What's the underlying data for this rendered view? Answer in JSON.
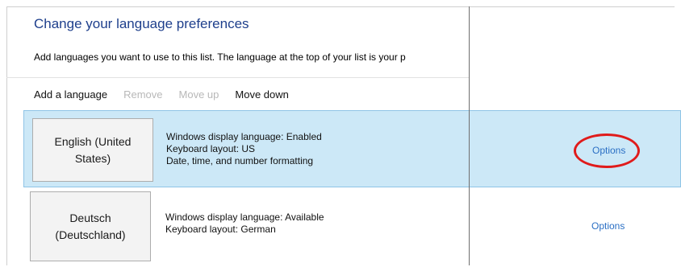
{
  "header": {
    "title": "Change your language preferences",
    "subtitle": "Add languages you want to use to this list. The language at the top of your list is your p"
  },
  "toolbar": {
    "add": "Add a language",
    "remove": "Remove",
    "move_up": "Move up",
    "move_down": "Move down"
  },
  "languages": [
    {
      "name_line1": "English (United",
      "name_line2": "States)",
      "display": "Windows display language: Enabled",
      "keyboard": "Keyboard layout: US",
      "formatting": "Date, time, and number formatting",
      "options": "Options",
      "selected": true
    },
    {
      "name_line1": "Deutsch",
      "name_line2": "(Deutschland)",
      "display": "Windows display language: Available",
      "keyboard": "Keyboard layout: German",
      "options": "Options",
      "selected": false
    }
  ],
  "colors": {
    "title": "#1e3f8c",
    "selection": "#cce8f7",
    "link": "#2a6fc4",
    "annotation": "#e01b1b"
  }
}
